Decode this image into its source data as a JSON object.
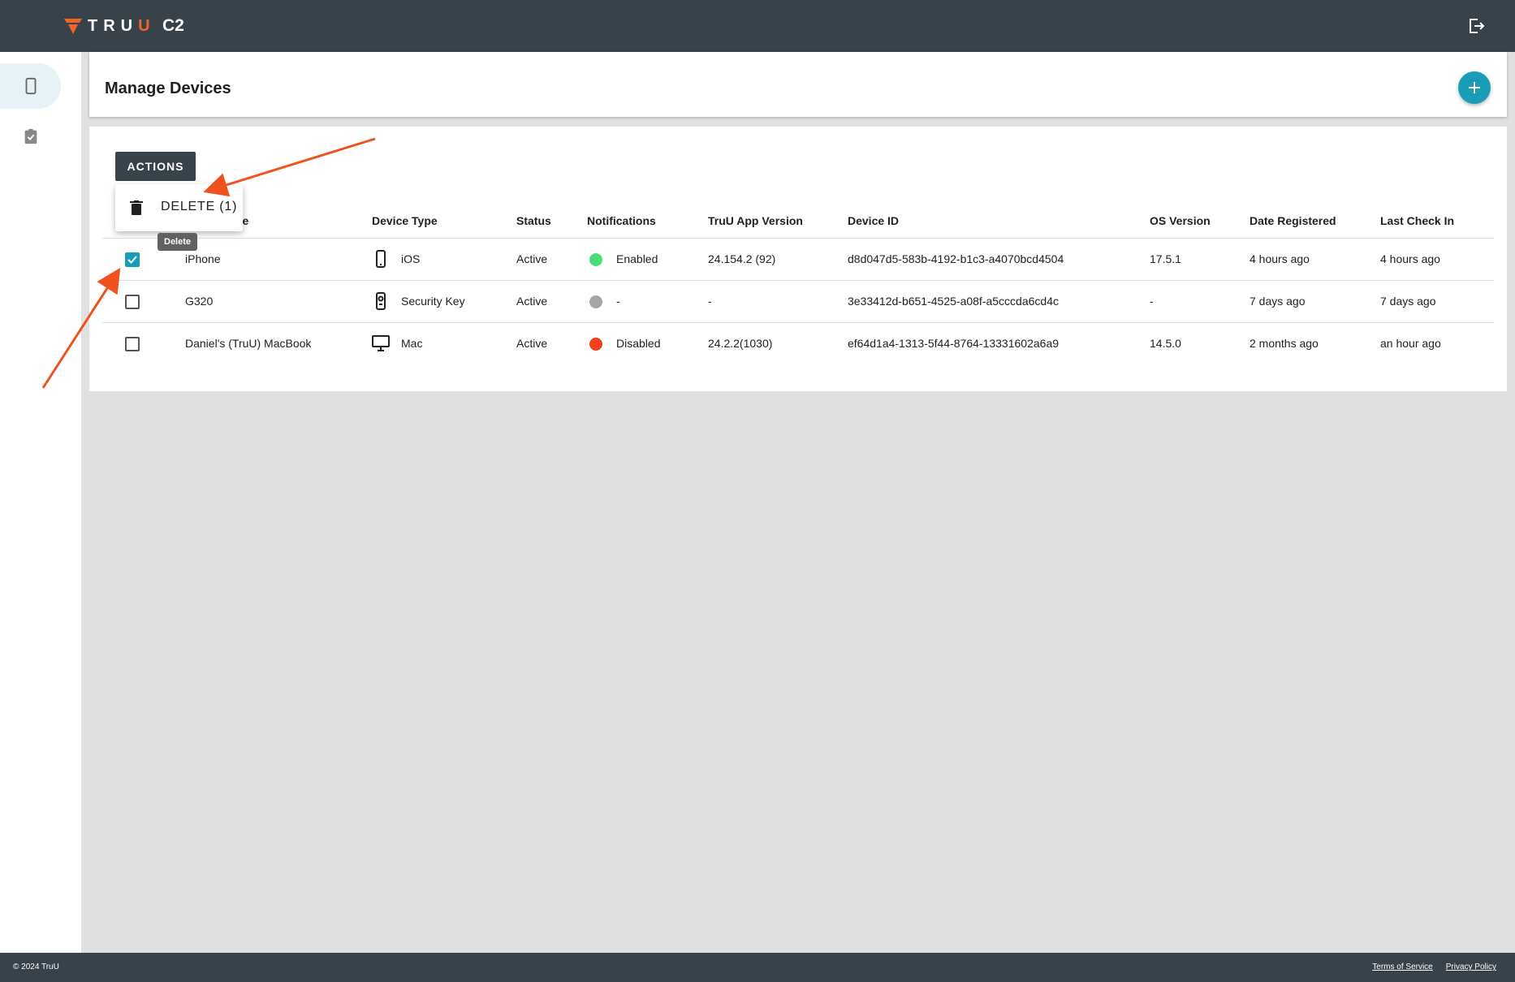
{
  "brand": {
    "logo_text_a": "TRU",
    "logo_text_b": "U",
    "app_name": "C2",
    "accent": "#f0642b",
    "primary": "#1a9bb6",
    "dark": "#37424b"
  },
  "sidebar": {
    "items": [
      {
        "icon": "phone-icon",
        "active": true
      },
      {
        "icon": "clipboard-check-icon",
        "active": false
      }
    ]
  },
  "header": {
    "title": "Manage Devices",
    "add_icon": "plus-icon"
  },
  "toolbar": {
    "actions_label": "ACTIONS"
  },
  "menu": {
    "delete_label": "DELETE (1)",
    "delete_icon": "trash-icon",
    "tooltip": "Delete"
  },
  "table": {
    "columns": {
      "name": "ne",
      "device_type": "Device Type",
      "status": "Status",
      "notifications": "Notifications",
      "app_version": "TruU App Version",
      "device_id": "Device ID",
      "os_version": "OS Version",
      "date_registered": "Date Registered",
      "last_check_in": "Last Check In"
    },
    "rows": [
      {
        "checked": true,
        "name": "iPhone",
        "device_type": "iOS",
        "device_icon": "phone-icon",
        "status": "Active",
        "notif_color": "#4cdb7a",
        "notifications": "Enabled",
        "app_version": "24.154.2 (92)",
        "device_id": "d8d047d5-583b-4192-b1c3-a4070bcd4504",
        "os_version": "17.5.1",
        "date_registered": "4 hours ago",
        "last_check_in": "4 hours ago"
      },
      {
        "checked": false,
        "name": "G320",
        "device_type": "Security Key",
        "device_icon": "security-key-icon",
        "status": "Active",
        "notif_color": "#a6a6a6",
        "notifications": "-",
        "app_version": "-",
        "device_id": "3e33412d-b651-4525-a08f-a5cccda6cd4c",
        "os_version": "-",
        "date_registered": "7 days ago",
        "last_check_in": "7 days ago"
      },
      {
        "checked": false,
        "name": "Daniel's (TruU) MacBook",
        "device_type": "Mac",
        "device_icon": "monitor-icon",
        "status": "Active",
        "notif_color": "#f04020",
        "notifications": "Disabled",
        "app_version": "24.2.2(1030)",
        "device_id": "ef64d1a4-1313-5f44-8764-13331602a6a9",
        "os_version": "14.5.0",
        "date_registered": "2 months ago",
        "last_check_in": "an hour ago"
      }
    ]
  },
  "footer": {
    "copyright": "© 2024 TruU",
    "terms": "Terms of Service",
    "privacy": "Privacy Policy"
  }
}
